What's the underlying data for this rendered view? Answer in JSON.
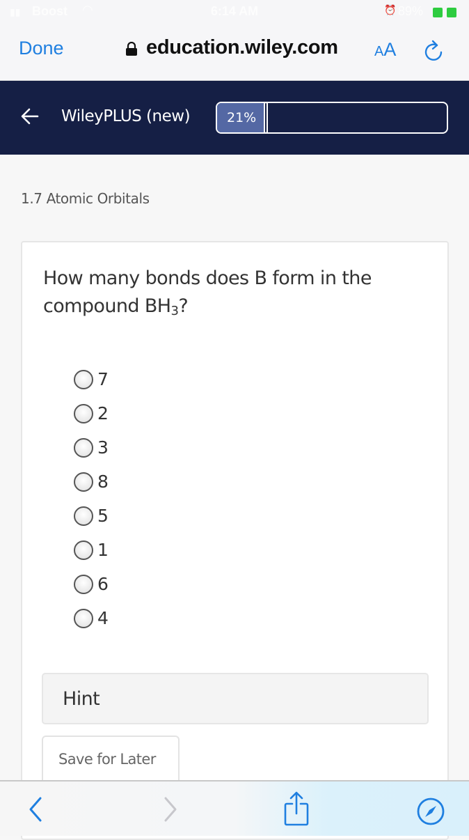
{
  "status_bar": {
    "carrier": "Boost",
    "time": "6:14 AM",
    "battery_percent": "89%",
    "icons": [
      "signal-icon",
      "wifi-icon",
      "alarm-icon",
      "battery-icon"
    ]
  },
  "browser": {
    "done_label": "Done",
    "host": "education.wiley.com",
    "text_size_label_small": "A",
    "text_size_label_large": "A",
    "icons": [
      "lock-icon",
      "reload-icon"
    ]
  },
  "app_header": {
    "back_icon": "arrow-left-icon",
    "title": "WileyPLUS (new)",
    "progress": {
      "label": "21%",
      "value_percent": 21
    }
  },
  "section": {
    "title": "1.7 Atomic Orbitals"
  },
  "question": {
    "text_before": "How many bonds does B form in the compound BH",
    "subscript": "3",
    "text_after": "?",
    "options": [
      {
        "label": "7",
        "selected": false
      },
      {
        "label": "2",
        "selected": false
      },
      {
        "label": "3",
        "selected": false
      },
      {
        "label": "8",
        "selected": false
      },
      {
        "label": "5",
        "selected": false
      },
      {
        "label": "1",
        "selected": false
      },
      {
        "label": "6",
        "selected": false
      },
      {
        "label": "4",
        "selected": false
      }
    ],
    "hint_label": "Hint",
    "save_label": "Save for Later"
  },
  "bottom_toolbar": {
    "icons": [
      "chevron-left-icon",
      "chevron-right-icon",
      "share-icon",
      "compass-icon"
    ],
    "accent_color": "#1f7fe0"
  },
  "colors": {
    "app_header_bg": "#151f45",
    "progress_fill": "#5468a4",
    "ios_blue": "#1f7fe0"
  }
}
